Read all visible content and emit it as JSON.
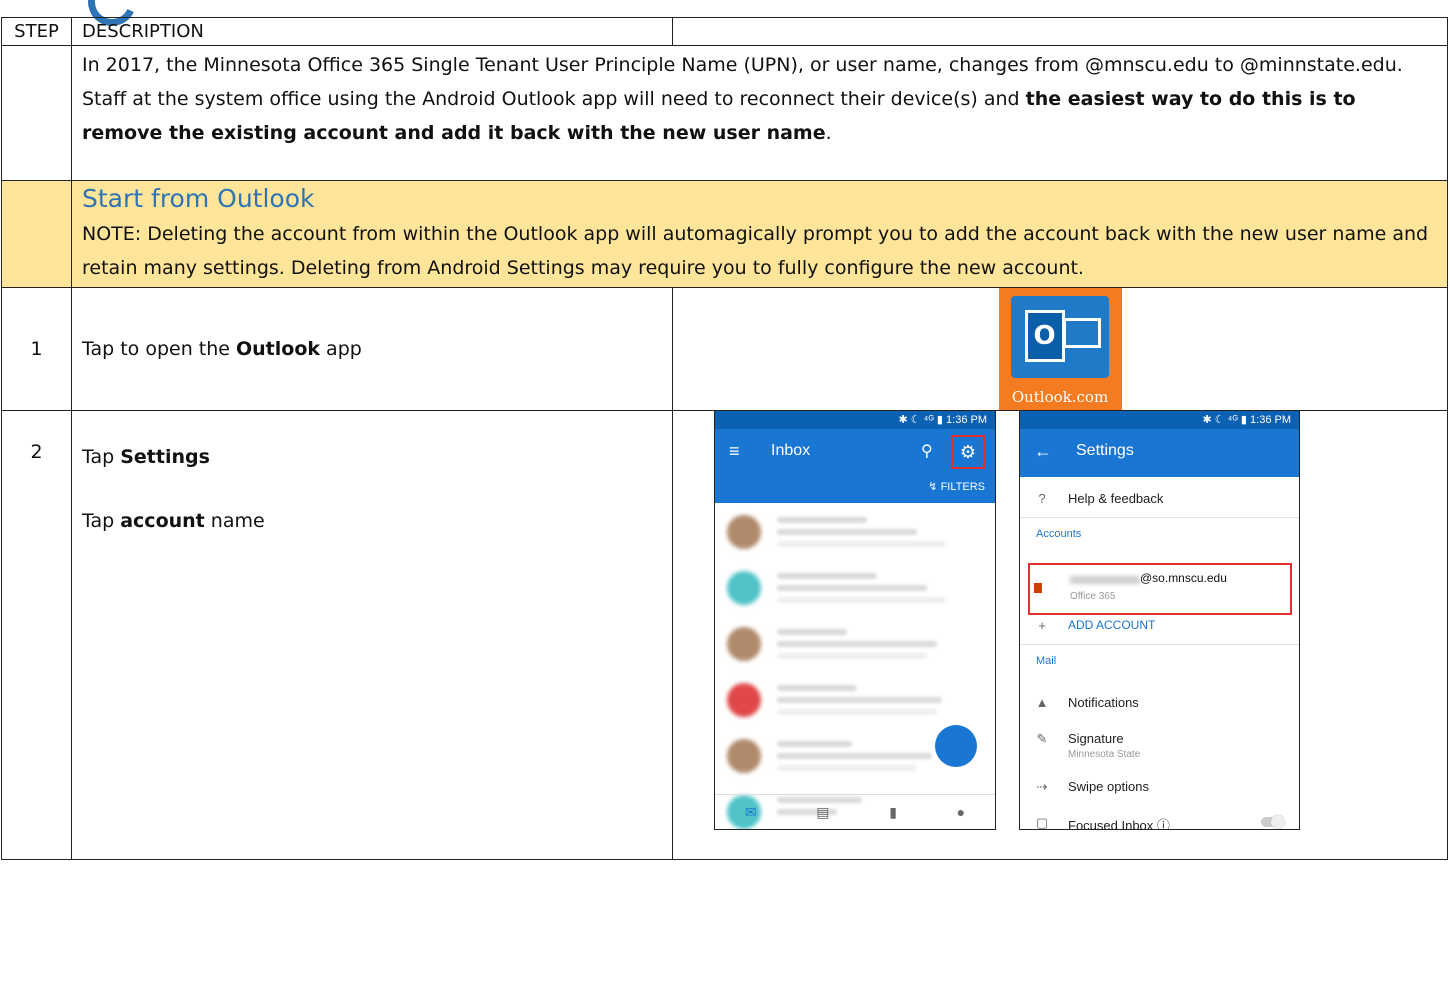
{
  "table": {
    "header": {
      "step": "STEP",
      "description": "DESCRIPTION"
    },
    "intro": {
      "text1": "In 2017, the Minnesota Office 365 Single Tenant User Principle Name (UPN), or user name, changes from @mnscu.edu to @minnstate.edu. Staff at the system office using the Android Outlook app will need to reconnect their device(s) and ",
      "bold": "the easiest way to do this is to remove the existing account and add it back with the new user name",
      "end": "."
    },
    "note": {
      "title": "Start from Outlook",
      "body": "NOTE: Deleting the account from within the Outlook app will automagically prompt you to add the account back with the new user name and retain many settings. Deleting from Android Settings may require you to fully configure the new account."
    },
    "step1": {
      "number": "1",
      "pre": "Tap to open the ",
      "bold": "Outlook",
      "post": " app"
    },
    "step2": {
      "number": "2",
      "line1_pre": "Tap ",
      "line1_bold": "Settings",
      "line2_pre": "Tap ",
      "line2_bold": "account",
      "line2_post": " name"
    }
  },
  "outlook_icon": {
    "letter": "O",
    "label": "Outlook.com"
  },
  "inbox_screen": {
    "status": "✱ ☾ ⁴ᴳ ▮ 1:36 PM",
    "title": "Inbox",
    "filters": "FILTERS",
    "icons": [
      "menu-icon",
      "search-icon",
      "gear-icon",
      "compose-icon",
      "mail-icon",
      "calendar-icon",
      "files-icon",
      "people-icon"
    ]
  },
  "settings_screen": {
    "status": "✱ ☾ ⁴ᴳ ▮ 1:36 PM",
    "title": "Settings",
    "help": "Help & feedback",
    "accounts_header": "Accounts",
    "account_email": "@so.mnscu.edu",
    "account_type": "Office 365",
    "add_account": "ADD ACCOUNT",
    "mail_header": "Mail",
    "notifications": "Notifications",
    "signature": "Signature",
    "signature_sub": "Minnesota State",
    "swipe": "Swipe options",
    "focused": "Focused Inbox"
  },
  "colors": {
    "note_bg": "#ffe599",
    "accent": "#2e74b5",
    "outlook_orange": "#f47b1f",
    "app_blue": "#1976d2",
    "highlight_red": "#e03030"
  }
}
